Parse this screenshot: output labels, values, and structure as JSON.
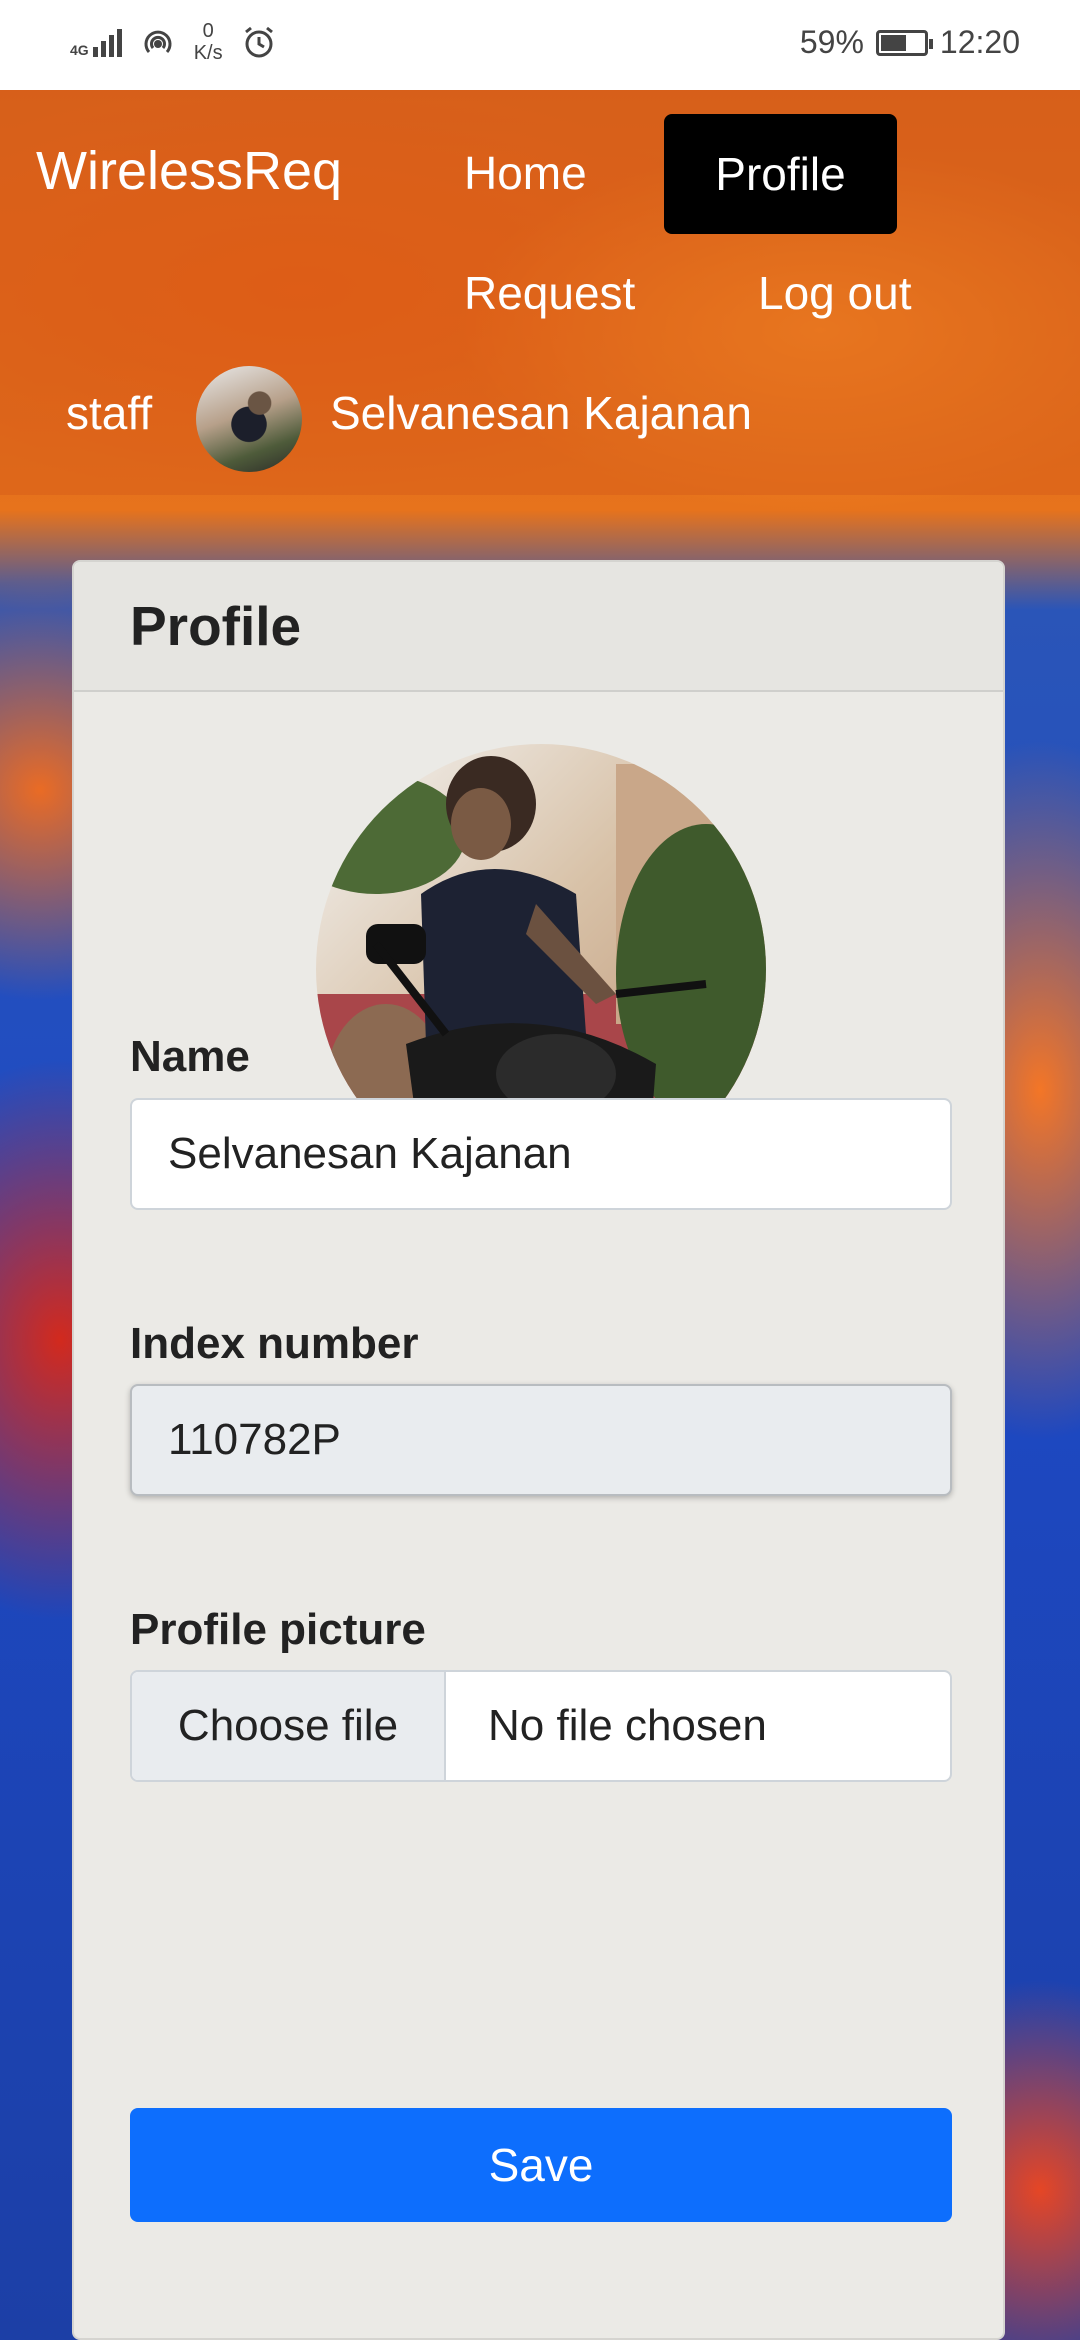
{
  "status_bar": {
    "network_type": "4G",
    "data_speed_value": "0",
    "data_speed_unit": "K/s",
    "battery_percent": "59%",
    "time": "12:20",
    "icons": [
      "signal-icon",
      "hotspot-icon",
      "alarm-icon",
      "battery-icon"
    ]
  },
  "navbar": {
    "brand": "WirelessReq",
    "links": {
      "home": "Home",
      "profile": "Profile",
      "request": "Request",
      "logout": "Log out"
    },
    "active_link": "Profile",
    "role": "staff",
    "username": "Selvanesan Kajanan"
  },
  "card": {
    "title": "Profile",
    "name_label": "Name",
    "name_value": "Selvanesan Kajanan",
    "index_label": "Index number",
    "index_value": "110782P",
    "picture_label": "Profile picture",
    "file_button_label": "Choose file",
    "file_status": "No file chosen",
    "save_label": "Save"
  },
  "colors": {
    "primary": "#0d6efd",
    "active_nav": "#000000",
    "card_bg": "#ebeae6"
  }
}
